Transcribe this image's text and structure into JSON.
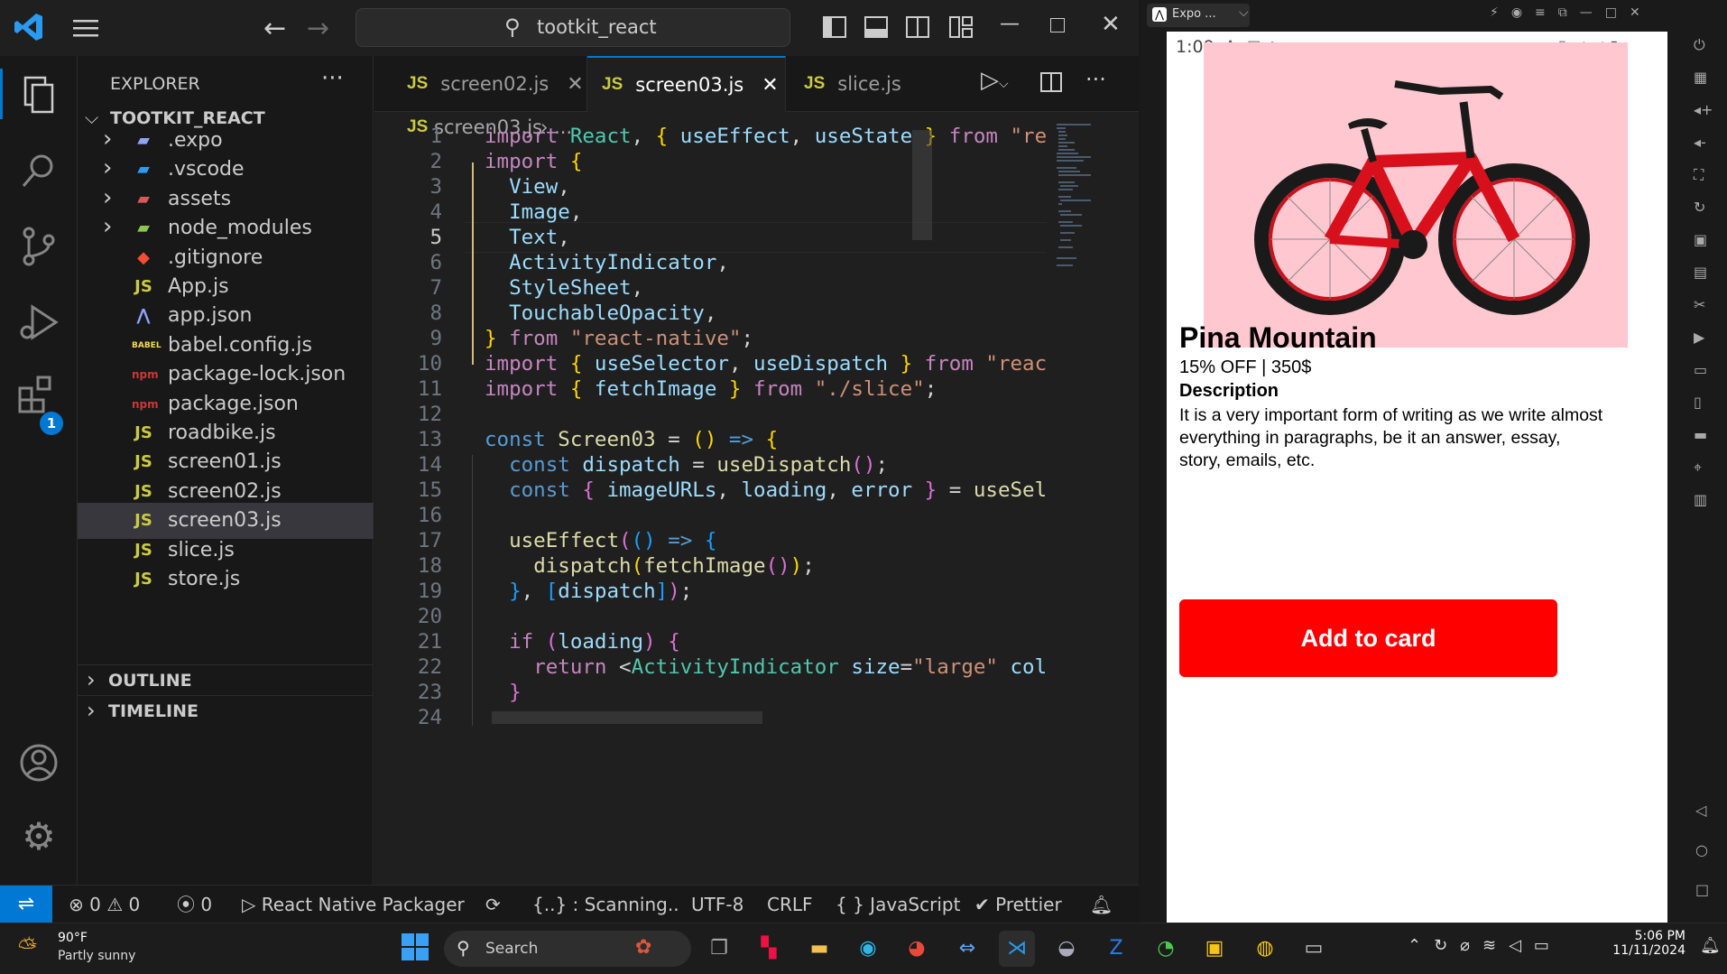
{
  "titlebar": {
    "search_text": "tootkit_react",
    "back_icon": "arrow-left-icon",
    "forward_icon": "arrow-right-icon"
  },
  "explorer": {
    "header": "EXPLORER",
    "more": "···",
    "root": "TOOTKIT_REACT",
    "items": [
      {
        "label": ".expo",
        "type": "folder",
        "icon": "expo-folder-icon"
      },
      {
        "label": ".vscode",
        "type": "folder",
        "icon": "vscode-folder-icon"
      },
      {
        "label": "assets",
        "type": "folder",
        "icon": "assets-folder-icon"
      },
      {
        "label": "node_modules",
        "type": "folder",
        "icon": "node-folder-icon"
      },
      {
        "label": ".gitignore",
        "type": "file",
        "icon": "git-icon"
      },
      {
        "label": "App.js",
        "type": "file",
        "icon": "JS"
      },
      {
        "label": "app.json",
        "type": "file",
        "icon": "expo-icon"
      },
      {
        "label": "babel.config.js",
        "type": "file",
        "icon": "BABEL"
      },
      {
        "label": "package-lock.json",
        "type": "file",
        "icon": "npm-icon"
      },
      {
        "label": "package.json",
        "type": "file",
        "icon": "npm-icon"
      },
      {
        "label": "roadbike.js",
        "type": "file",
        "icon": "JS"
      },
      {
        "label": "screen01.js",
        "type": "file",
        "icon": "JS"
      },
      {
        "label": "screen02.js",
        "type": "file",
        "icon": "JS"
      },
      {
        "label": "screen03.js",
        "type": "file",
        "icon": "JS",
        "selected": true
      },
      {
        "label": "slice.js",
        "type": "file",
        "icon": "JS"
      },
      {
        "label": "store.js",
        "type": "file",
        "icon": "JS"
      }
    ],
    "outline": "OUTLINE",
    "timeline": "TIMELINE"
  },
  "activity_badge": "1",
  "tabs": [
    {
      "label": "screen02.js",
      "icon": "JS",
      "close": "✕",
      "active": false
    },
    {
      "label": "screen03.js",
      "icon": "JS",
      "close": "✕",
      "active": true
    },
    {
      "label": "slice.js",
      "icon": "JS",
      "close": "",
      "active": false
    }
  ],
  "breadcrumb": {
    "icon": "JS",
    "file": "screen03.js",
    "rest": "› ..."
  },
  "code_lines": [
    "1",
    "2",
    "3",
    "4",
    "5",
    "6",
    "7",
    "8",
    "9",
    "10",
    "11",
    "12",
    "13",
    "14",
    "15",
    "16",
    "17",
    "18",
    "19",
    "20",
    "21",
    "22",
    "23",
    "24"
  ],
  "statusbar": {
    "errors": "0",
    "warnings": "0",
    "ports": "0",
    "packager": "React Native Packager",
    "scanning": "{..} : Scanning..",
    "encoding": "UTF-8",
    "eol": "CRLF",
    "language": "{ } JavaScript",
    "prettier": "Prettier"
  },
  "phone_window": {
    "tab_title": "Expo ...",
    "time": "1:09"
  },
  "app": {
    "product_name": "Pina Mountain",
    "price_line": "15% OFF | 350$",
    "description_title": "Description",
    "description": "It is a very important form of writing as we write almost everything in paragraphs, be it an answer, essay, story, emails, etc.",
    "button_label": "Add to card",
    "image_bg": "#ffc7cf",
    "button_color": "#ff0000"
  },
  "taskbar": {
    "weather_temp": "90°F",
    "weather_desc": "Partly sunny",
    "search": "Search",
    "time": "5:06 PM",
    "date": "11/11/2024"
  }
}
